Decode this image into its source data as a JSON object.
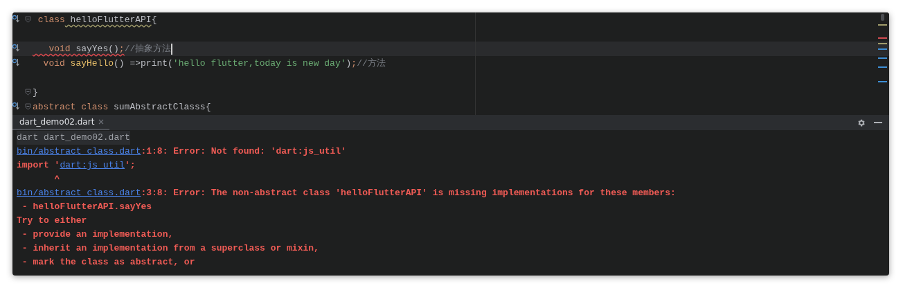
{
  "editor": {
    "lines": [
      {
        "override": true,
        "fold": true,
        "current": false,
        "tokens": [
          {
            "text": " class",
            "kind": "keyword"
          },
          {
            "text": " helloFlutterAPI",
            "kind": "plain",
            "warning": true
          },
          {
            "text": "{",
            "kind": "plain"
          }
        ]
      },
      {
        "override": false,
        "fold": false,
        "current": false
      },
      {
        "override": true,
        "fold": false,
        "current": true,
        "tokens": [
          {
            "text": "   void",
            "kind": "keyword",
            "error": true
          },
          {
            "text": " sayYes()",
            "kind": "plain",
            "error": true
          },
          {
            "text": ";",
            "kind": "keyword",
            "error": true
          },
          {
            "text": "//抽象方法",
            "kind": "comment"
          }
        ]
      },
      {
        "override": true,
        "fold": false,
        "current": false,
        "tokens": [
          {
            "text": "  void",
            "kind": "keyword"
          },
          {
            "text": " sayHello",
            "kind": "function"
          },
          {
            "text": "() =>print(",
            "kind": "plain"
          },
          {
            "text": "'hello flutter,today is new day'",
            "kind": "string"
          },
          {
            "text": ")",
            "kind": "plain"
          },
          {
            "text": ";",
            "kind": "keyword"
          },
          {
            "text": "//方法",
            "kind": "comment"
          }
        ]
      },
      {
        "override": false,
        "fold": false,
        "current": false
      },
      {
        "override": false,
        "fold": true,
        "current": false,
        "tokens": [
          {
            "text": "}",
            "kind": "plain"
          }
        ]
      },
      {
        "override": true,
        "fold": true,
        "current": false,
        "tokens": [
          {
            "text": "abstract class",
            "kind": "keyword"
          },
          {
            "text": " sumAbstractClasss{",
            "kind": "plain"
          }
        ]
      }
    ]
  },
  "run_panel": {
    "tabs": [
      {
        "label": "dart_demo02.dart",
        "selected": true
      }
    ],
    "console": [
      {
        "kind": "command",
        "segments": [
          {
            "text": "dart dart_demo02.dart",
            "kind": "plain"
          }
        ]
      },
      {
        "kind": "error",
        "segments": [
          {
            "text": "bin/abstract_class.dart",
            "kind": "link"
          },
          {
            "text": ":1:8: Error: Not found: 'dart:js_util'",
            "kind": "plain"
          }
        ]
      },
      {
        "kind": "error",
        "segments": [
          {
            "text": "import '",
            "kind": "plain"
          },
          {
            "text": "dart:js_util",
            "kind": "link"
          },
          {
            "text": "';",
            "kind": "plain"
          }
        ]
      },
      {
        "kind": "error",
        "segments": [
          {
            "text": "       ^",
            "kind": "plain"
          }
        ]
      },
      {
        "kind": "error",
        "segments": [
          {
            "text": "bin/abstract_class.dart",
            "kind": "link"
          },
          {
            "text": ":3:8: Error: The non-abstract class 'helloFlutterAPI' is missing implementations for these members:",
            "kind": "plain"
          }
        ]
      },
      {
        "kind": "error",
        "segments": [
          {
            "text": " - helloFlutterAPI.sayYes",
            "kind": "plain"
          }
        ]
      },
      {
        "kind": "error",
        "segments": [
          {
            "text": "Try to either",
            "kind": "plain"
          }
        ]
      },
      {
        "kind": "error",
        "segments": [
          {
            "text": " - provide an implementation,",
            "kind": "plain"
          }
        ]
      },
      {
        "kind": "error",
        "segments": [
          {
            "text": " - inherit an implementation from a superclass or mixin,",
            "kind": "plain"
          }
        ]
      },
      {
        "kind": "error",
        "segments": [
          {
            "text": " - mark the class as abstract, or",
            "kind": "plain"
          }
        ]
      }
    ]
  }
}
